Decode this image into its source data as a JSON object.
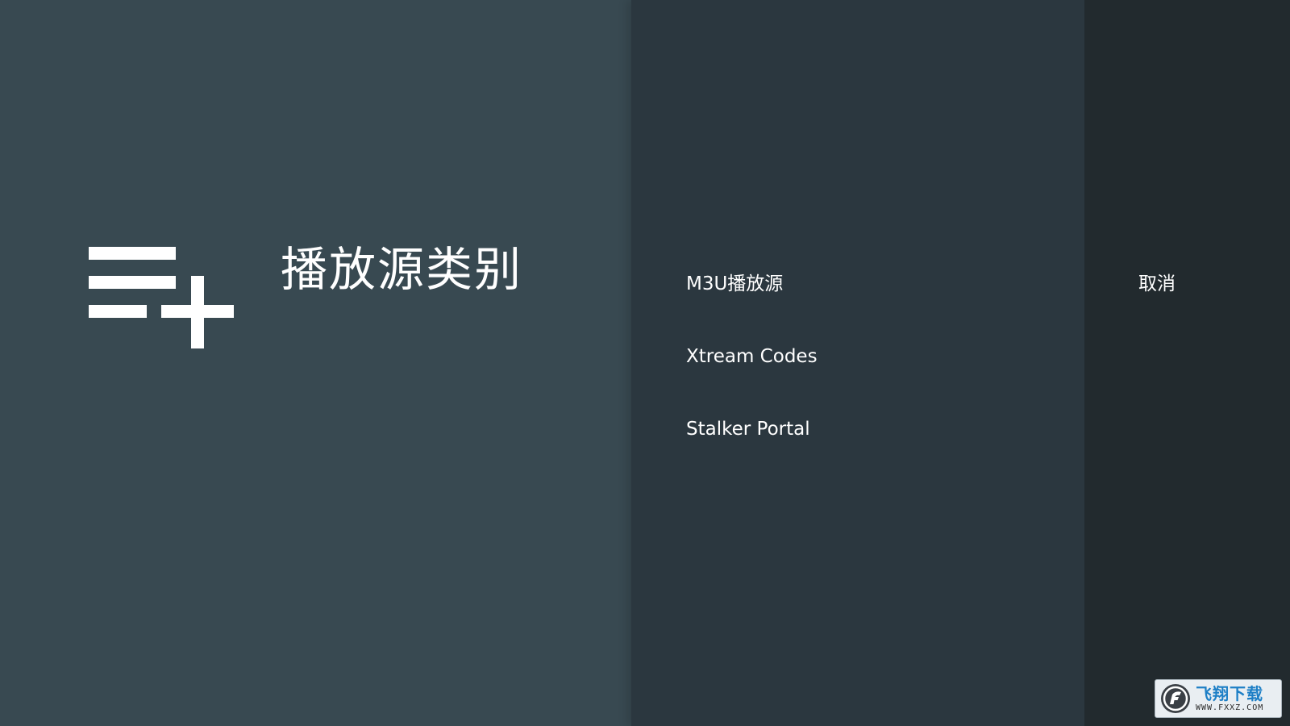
{
  "guidance": {
    "title": "播放源类别",
    "icon": "playlist-add-icon"
  },
  "options": {
    "items": [
      {
        "label": "M3U播放源"
      },
      {
        "label": "Xtream Codes"
      },
      {
        "label": "Stalker Portal"
      }
    ]
  },
  "actions": {
    "cancel_label": "取消"
  },
  "watermark": {
    "brand": "飞翔下载",
    "site": "WWW.FXXZ.COM"
  },
  "colors": {
    "guidance_bg": "#384951",
    "options_bg": "#2b373f",
    "actions_bg": "#222a2e",
    "text": "#ffffff"
  }
}
